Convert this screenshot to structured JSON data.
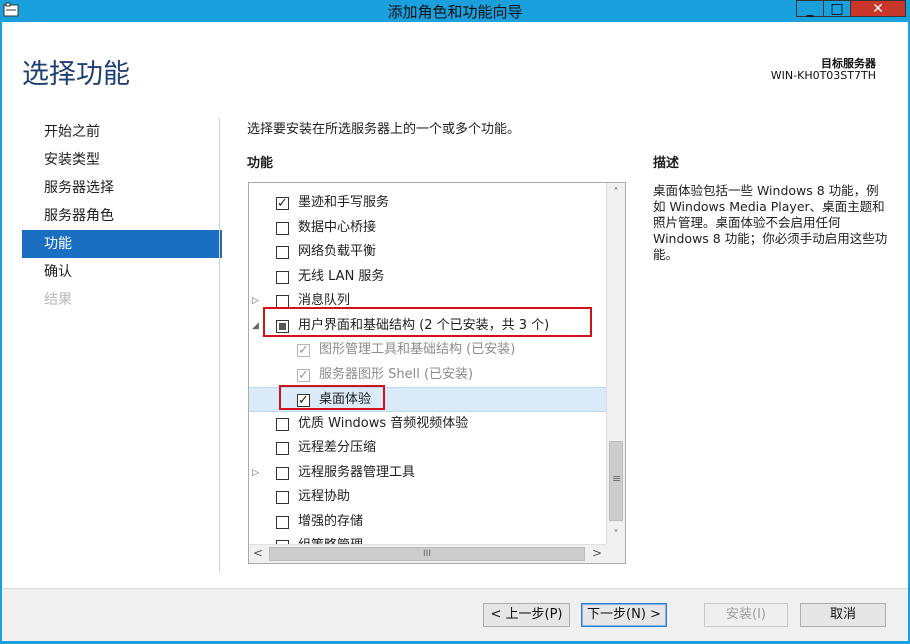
{
  "window": {
    "title": "添加角色和功能向导",
    "min_symbol": "_",
    "max_symbol": "□",
    "close_symbol": "✕"
  },
  "header": {
    "page_title": "选择功能",
    "target_label": "目标服务器",
    "target_value": "WIN-KH0T03ST7TH"
  },
  "nav": {
    "items": [
      {
        "label": "开始之前",
        "state": "normal"
      },
      {
        "label": "安装类型",
        "state": "normal"
      },
      {
        "label": "服务器选择",
        "state": "normal"
      },
      {
        "label": "服务器角色",
        "state": "normal"
      },
      {
        "label": "功能",
        "state": "active"
      },
      {
        "label": "确认",
        "state": "normal"
      },
      {
        "label": "结果",
        "state": "disabled"
      }
    ]
  },
  "main": {
    "intro": "选择要安装在所选服务器上的一个或多个功能。",
    "features_label": "功能",
    "description_label": "描述",
    "description_text": "桌面体验包括一些 Windows 8 功能，例如 Windows Media Player、桌面主题和照片管理。桌面体验不会启用任何 Windows 8 功能；你必须手动启用这些功能。",
    "features": [
      {
        "label": "墨迹和手写服务",
        "checked": true
      },
      {
        "label": "数据中心桥接",
        "checked": false
      },
      {
        "label": "网络负载平衡",
        "checked": false
      },
      {
        "label": "无线 LAN 服务",
        "checked": false
      },
      {
        "label": "消息队列",
        "checked": false,
        "expander": "▷"
      },
      {
        "label": "用户界面和基础结构 (2 个已安装，共 3 个)",
        "partial": true,
        "expander": "◢"
      },
      {
        "label": "图形管理工具和基础结构 (已安装)",
        "checked": true,
        "disabled": true
      },
      {
        "label": "服务器图形 Shell (已安装)",
        "checked": true,
        "disabled": true
      },
      {
        "label": "桌面体验",
        "checked": true,
        "selected": true
      },
      {
        "label": "优质 Windows 音频视频体验",
        "checked": false
      },
      {
        "label": "远程差分压缩",
        "checked": false
      },
      {
        "label": "远程服务器管理工具",
        "checked": false,
        "expander": "▷"
      },
      {
        "label": "远程协助",
        "checked": false
      },
      {
        "label": "增强的存储",
        "checked": false
      },
      {
        "label": "组策略管理",
        "checked": false
      }
    ]
  },
  "scroll": {
    "up": "˄",
    "down": "˅",
    "left": "<",
    "right": ">",
    "h_thumb": "III"
  },
  "footer": {
    "prev": "< 上一步(P)",
    "next": "下一步(N) >",
    "install": "安装(I)",
    "cancel": "取消"
  },
  "colors": {
    "titlebar": "#1aa0dd",
    "nav_active": "#1b6fc3",
    "highlight_box": "#d0121b",
    "page_title": "#1e3f73"
  }
}
